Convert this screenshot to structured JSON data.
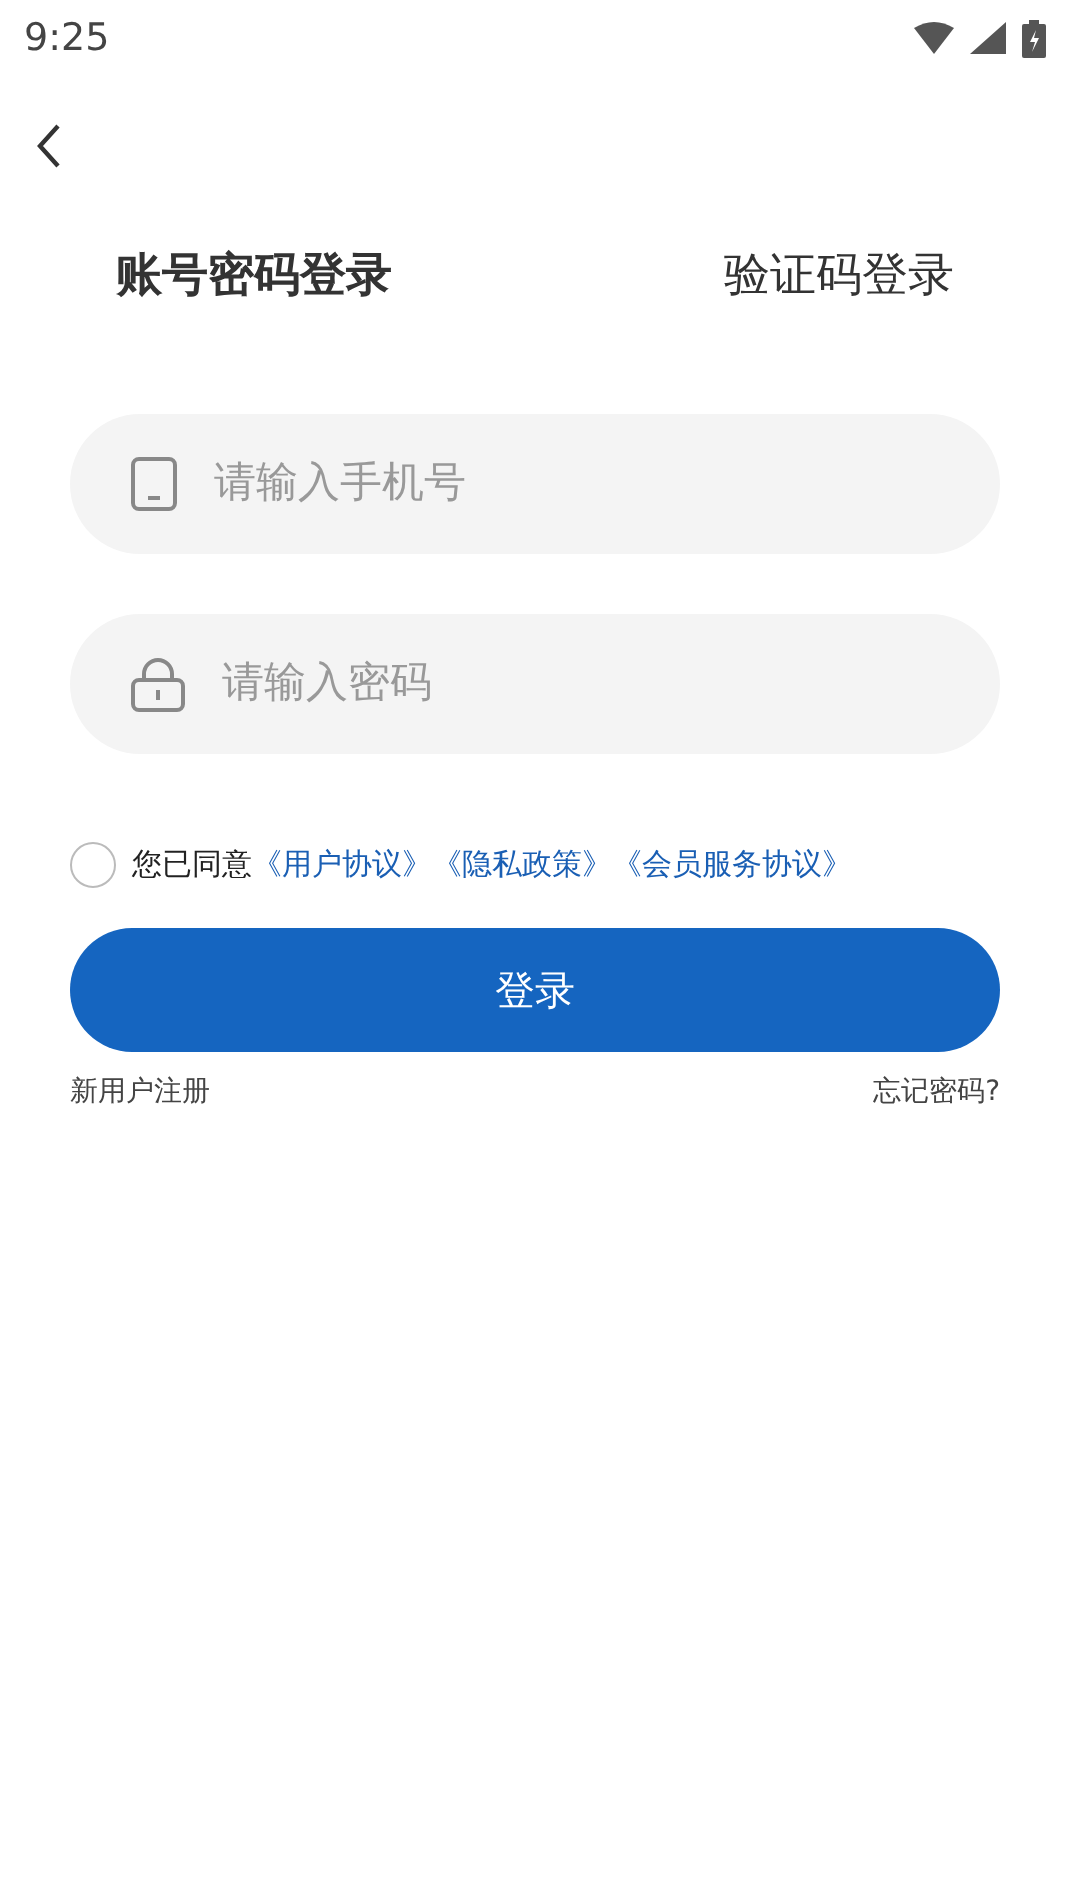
{
  "status_bar": {
    "time": "9:25"
  },
  "tabs": [
    {
      "label": "账号密码登录",
      "selected": true
    },
    {
      "label": "验证码登录",
      "selected": false
    }
  ],
  "fields": [
    {
      "kind": "phone",
      "placeholder": "请输入手机号"
    },
    {
      "kind": "password",
      "placeholder": "请输入密码"
    }
  ],
  "agreement": {
    "checked": false,
    "text": "您已同意",
    "links": [
      "《用户协议》",
      "《隐私政策》",
      "《会员服务协议》"
    ]
  },
  "login_button": "登录",
  "register_link": "新用户注册",
  "forgot_link": "忘记密码?"
}
